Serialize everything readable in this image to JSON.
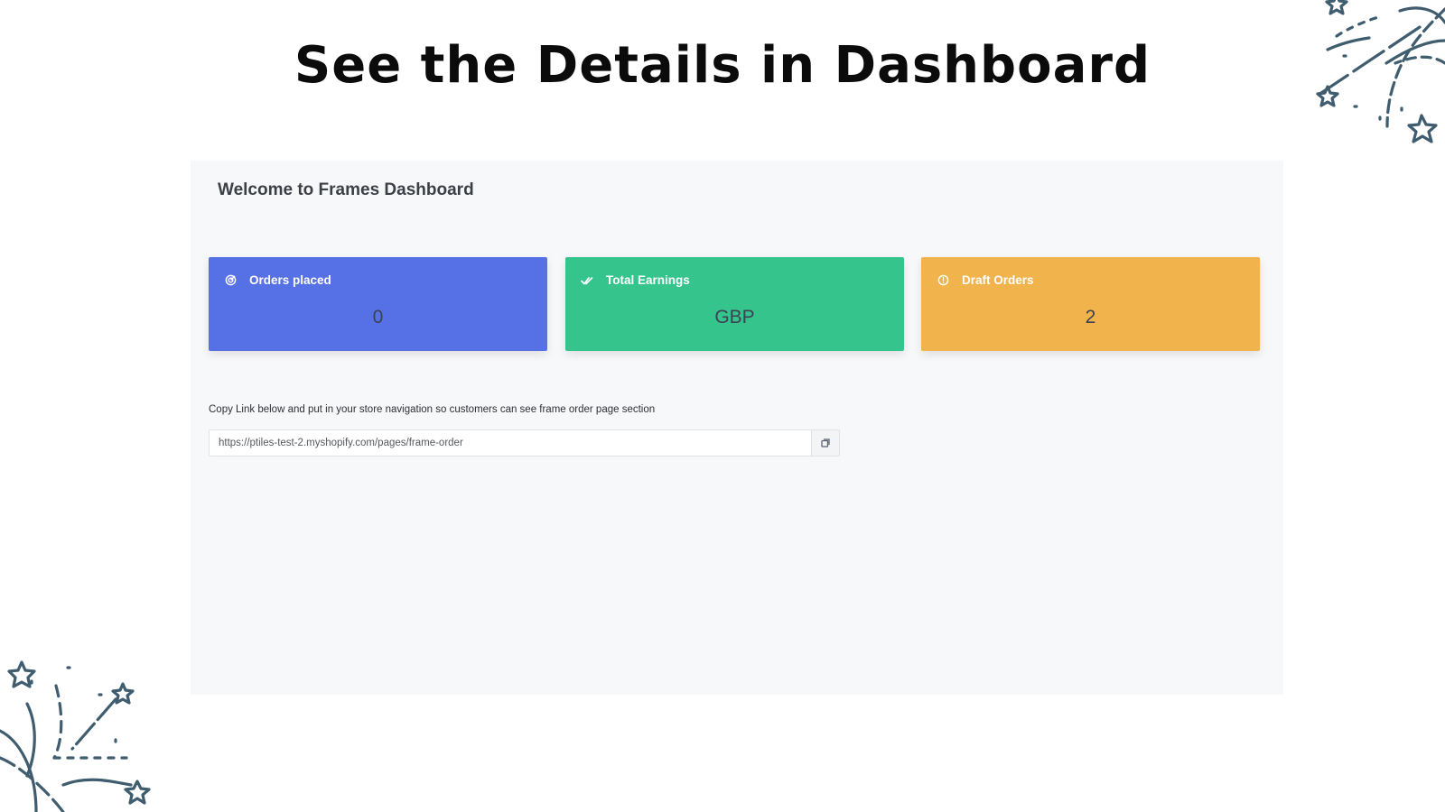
{
  "hero": {
    "title": "See the Details in Dashboard"
  },
  "dashboard": {
    "welcome": "Welcome to Frames Dashboard",
    "cards": [
      {
        "label": "Orders placed",
        "value": "0",
        "icon": "target-icon",
        "color": "#5670e6"
      },
      {
        "label": "Total Earnings",
        "value": "GBP",
        "icon": "double-check-icon",
        "color": "#36c48d"
      },
      {
        "label": "Draft Orders",
        "value": "2",
        "icon": "info-circle-icon",
        "color": "#f1b34c"
      }
    ],
    "copy_label": "Copy Link below and put in your store navigation so customers can see frame order page section",
    "link_value": "https://ptiles-test-2.myshopify.com/pages/frame-order",
    "copy_icon": "copy-icon"
  },
  "decorations": {
    "icon": "shooting-stars-icon",
    "color": "#3f5d6e"
  }
}
